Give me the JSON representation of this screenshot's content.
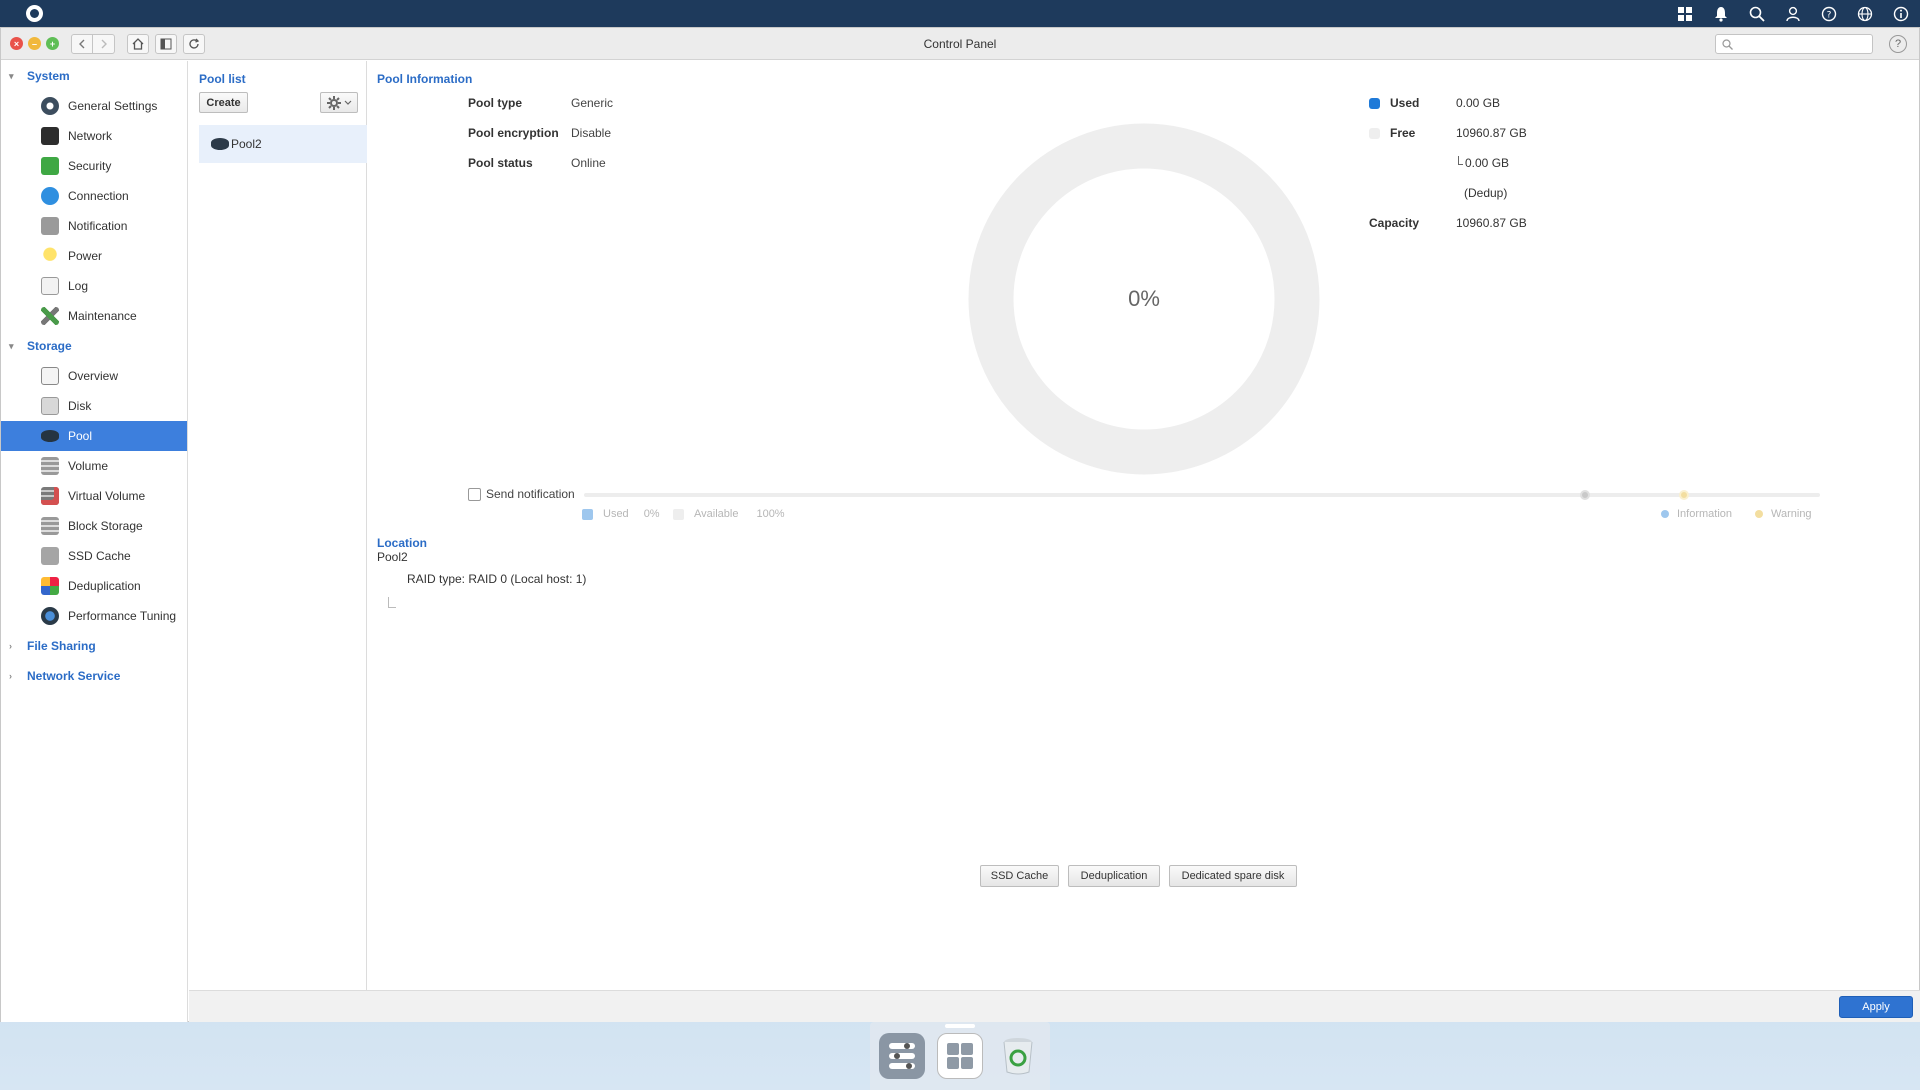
{
  "window": {
    "title": "Control Panel"
  },
  "search": {
    "placeholder": ""
  },
  "sidebar": {
    "sections": [
      {
        "label": "System",
        "expanded": true
      },
      {
        "label": "Storage",
        "expanded": true
      },
      {
        "label": "File Sharing",
        "expanded": false
      },
      {
        "label": "Network Service",
        "expanded": false
      }
    ],
    "system_items": [
      {
        "label": "General Settings",
        "icon": "general-settings-icon"
      },
      {
        "label": "Network",
        "icon": "network-icon"
      },
      {
        "label": "Security",
        "icon": "security-icon"
      },
      {
        "label": "Connection",
        "icon": "connection-icon"
      },
      {
        "label": "Notification",
        "icon": "notification-icon"
      },
      {
        "label": "Power",
        "icon": "power-icon"
      },
      {
        "label": "Log",
        "icon": "log-icon"
      },
      {
        "label": "Maintenance",
        "icon": "maintenance-icon"
      }
    ],
    "storage_items": [
      {
        "label": "Overview",
        "icon": "overview-icon"
      },
      {
        "label": "Disk",
        "icon": "disk-icon"
      },
      {
        "label": "Pool",
        "icon": "pool-icon",
        "active": true
      },
      {
        "label": "Volume",
        "icon": "volume-icon"
      },
      {
        "label": "Virtual Volume",
        "icon": "virtual-volume-icon"
      },
      {
        "label": "Block Storage",
        "icon": "block-storage-icon"
      },
      {
        "label": "SSD Cache",
        "icon": "ssd-cache-icon"
      },
      {
        "label": "Deduplication",
        "icon": "deduplication-icon"
      },
      {
        "label": "Performance Tuning",
        "icon": "performance-tuning-icon"
      }
    ]
  },
  "pool_list": {
    "title": "Pool list",
    "create_label": "Create",
    "items": [
      {
        "label": "Pool2"
      }
    ]
  },
  "pool_info": {
    "title": "Pool Information",
    "rows": [
      {
        "key": "Pool type",
        "value": "Generic"
      },
      {
        "key": "Pool encryption",
        "value": "Disable"
      },
      {
        "key": "Pool status",
        "value": "Online"
      }
    ],
    "usage_percent_label": "0%",
    "used_fraction": 0,
    "legend": {
      "used_label": "Used",
      "used_value": "0.00 GB",
      "free_label": "Free",
      "free_value": "10960.87 GB",
      "dedup_value": "0.00 GB",
      "dedup_label": "(Dedup)",
      "capacity_label": "Capacity",
      "capacity_value": "10960.87 GB"
    },
    "colors": {
      "used": "#1f7ad8",
      "free": "#eeeeee",
      "info": "#9ec7ee",
      "warning": "#f3dea0"
    }
  },
  "notification": {
    "label": "Send notification",
    "checked": false,
    "used_label": "Used",
    "used_value": "0%",
    "available_label": "Available",
    "available_value": "100%",
    "information_label": "Information",
    "warning_label": "Warning",
    "information_threshold_fraction": 0.81,
    "warning_threshold_fraction": 0.89
  },
  "location": {
    "title": "Location",
    "pool": "Pool2",
    "raid": "RAID type: RAID 0 (Local host: 1)"
  },
  "actions": {
    "ssd_cache": "SSD Cache",
    "deduplication": "Deduplication",
    "spare_disk": "Dedicated spare disk"
  },
  "footer": {
    "apply_label": "Apply"
  }
}
